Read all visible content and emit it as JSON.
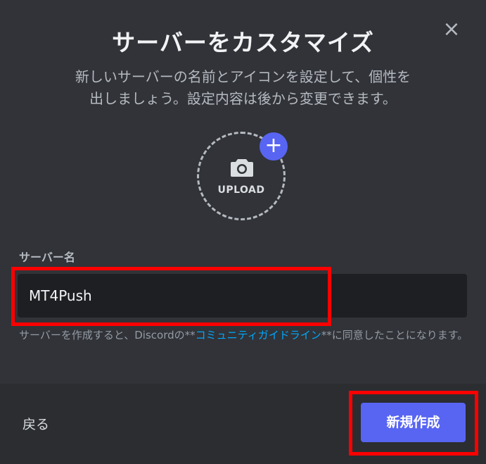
{
  "dialog": {
    "title": "サーバーをカスタマイズ",
    "subtitle_line1": "新しいサーバーの名前とアイコンを設定して、個性を",
    "subtitle_line2": "出しましょう。設定内容は後から変更できます。",
    "close_icon": "×"
  },
  "upload": {
    "label": "UPLOAD",
    "plus_icon": "+"
  },
  "server_name": {
    "label": "サーバー名",
    "value": "MT4Push"
  },
  "guidelines": {
    "prefix": "サーバーを作成すると、Discordの**",
    "link": "コミュニティガイドライン",
    "suffix": "**に同意したことになります。"
  },
  "footer": {
    "back_label": "戻る",
    "create_label": "新規作成"
  },
  "colors": {
    "background": "#313338",
    "footer_bg": "#2b2d31",
    "accent": "#5865f2",
    "link": "#00a8fc",
    "highlight": "#ff0000"
  }
}
